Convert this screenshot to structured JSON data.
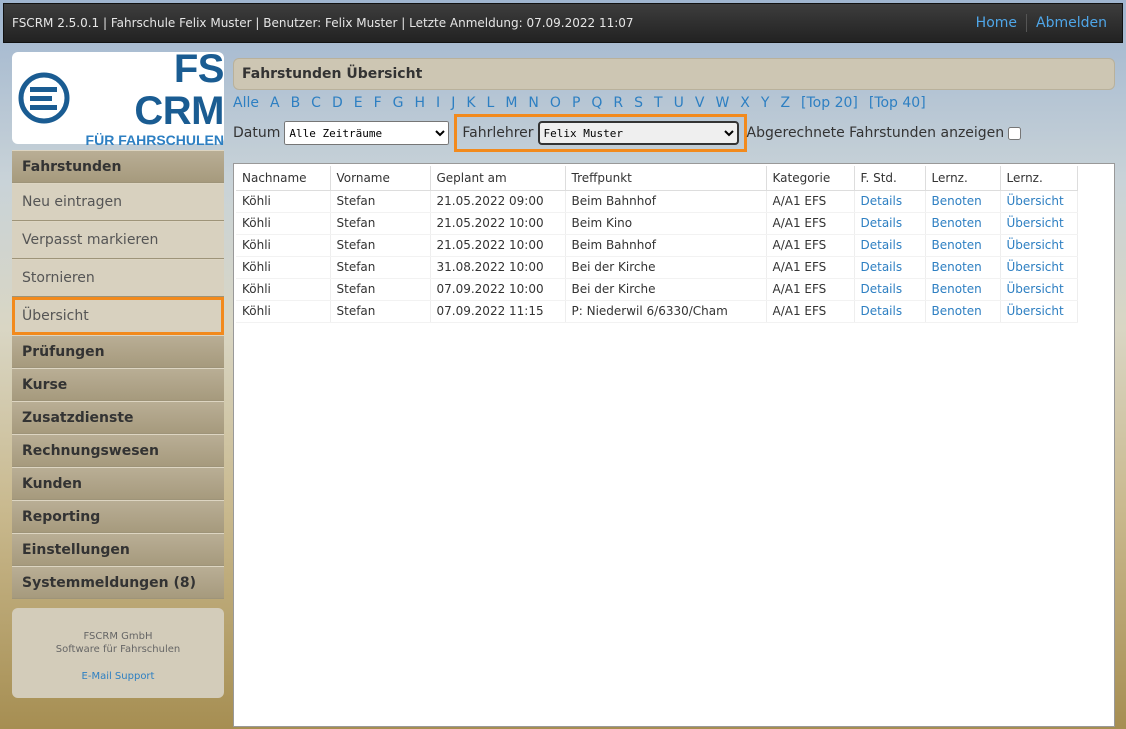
{
  "topbar": {
    "info": "FSCRM 2.5.0.1 | Fahrschule Felix Muster | Benutzer: Felix Muster | Letzte Anmeldung: 07.09.2022 11:07",
    "home": "Home",
    "logout": "Abmelden"
  },
  "logo": {
    "big": "FS CRM",
    "small": "FÜR FAHRSCHULEN"
  },
  "sidebar": {
    "fahrstunden": "Fahrstunden",
    "neu": "Neu eintragen",
    "verpasst": "Verpasst markieren",
    "stornieren": "Stornieren",
    "uebersicht": "Übersicht",
    "pruefungen": "Prüfungen",
    "kurse": "Kurse",
    "zusatz": "Zusatzdienste",
    "rechnung": "Rechnungswesen",
    "kunden": "Kunden",
    "reporting": "Reporting",
    "einstellungen": "Einstellungen",
    "system": "Systemmeldungen (8)"
  },
  "footer": {
    "company": "FSCRM GmbH",
    "tagline": "Software für Fahrschulen",
    "support": "E-Mail Support"
  },
  "main": {
    "title": "Fahrstunden Übersicht",
    "alpha": [
      "Alle",
      "A",
      "B",
      "C",
      "D",
      "E",
      "F",
      "G",
      "H",
      "I",
      "J",
      "K",
      "L",
      "M",
      "N",
      "O",
      "P",
      "Q",
      "R",
      "S",
      "T",
      "U",
      "V",
      "W",
      "X",
      "Y",
      "Z",
      "[Top 20]",
      "[Top 40]"
    ],
    "datum_label": "Datum",
    "datum_value": "Alle Zeiträume",
    "fahrlehrer_label": "Fahrlehrer",
    "fahrlehrer_value": "Felix Muster",
    "abgerechnet_label": "Abgerechnete Fahrstunden anzeigen"
  },
  "table": {
    "headers": [
      "Nachname",
      "Vorname",
      "Geplant am",
      "Treffpunkt",
      "Kategorie",
      "F. Std.",
      "Lernz.",
      "Lernz."
    ],
    "rows": [
      [
        "Köhli",
        "Stefan",
        "21.05.2022 09:00",
        "Beim Bahnhof",
        "A/A1 EFS",
        "Details",
        "Benoten",
        "Übersicht"
      ],
      [
        "Köhli",
        "Stefan",
        "21.05.2022 10:00",
        "Beim Kino",
        "A/A1 EFS",
        "Details",
        "Benoten",
        "Übersicht"
      ],
      [
        "Köhli",
        "Stefan",
        "21.05.2022 10:00",
        "Beim Bahnhof",
        "A/A1 EFS",
        "Details",
        "Benoten",
        "Übersicht"
      ],
      [
        "Köhli",
        "Stefan",
        "31.08.2022 10:00",
        "Bei der Kirche",
        "A/A1 EFS",
        "Details",
        "Benoten",
        "Übersicht"
      ],
      [
        "Köhli",
        "Stefan",
        "07.09.2022 10:00",
        "Bei der Kirche",
        "A/A1 EFS",
        "Details",
        "Benoten",
        "Übersicht"
      ],
      [
        "Köhli",
        "Stefan",
        "07.09.2022 11:15",
        "P: Niederwil 6/6330/Cham",
        "A/A1 EFS",
        "Details",
        "Benoten",
        "Übersicht"
      ]
    ]
  }
}
